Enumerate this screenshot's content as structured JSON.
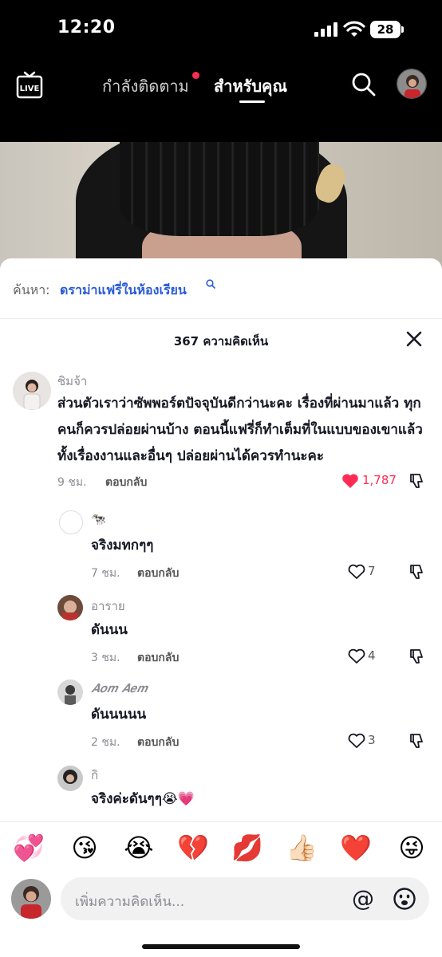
{
  "status_bar": {
    "time": "12:20",
    "battery": "28"
  },
  "top_nav": {
    "live_label": "LIVE",
    "following_tab": "กำลังติดตาม",
    "for_you_tab": "สำหรับคุณ"
  },
  "search_suggestion": {
    "prefix": "ค้นหา:",
    "query": "ดราม่าแฟรี่ในห้องเรียน"
  },
  "comments_header": {
    "count_label": "367 ความคิดเห็น"
  },
  "comments": [
    {
      "username": "ชิมจ้า",
      "text": "ส่วนตัวเราว่าซัพพอร์ตปัจจุบันดีกว่านะคะ เรื่องที่ผ่านมาแล้ว ทุกคนก็ควรปล่อยผ่านบ้าง ตอนนี้แฟรี่ก็ทำเต็มที่ในแบบของเขาแล้ว ทั้งเรื่องงานและอื่นๆ ปล่อยผ่านได้ควรทำนะคะ",
      "time": "9 ชม.",
      "reply_label": "ตอบกลับ",
      "likes": "1,787",
      "liked": true
    },
    {
      "username": "🐄",
      "text": "จริงมทกๆๆ",
      "time": "7 ชม.",
      "reply_label": "ตอบกลับ",
      "likes": "7",
      "liked": false
    },
    {
      "username": "อาราย",
      "text": "ดันนน",
      "time": "3 ชม.",
      "reply_label": "ตอบกลับ",
      "likes": "4",
      "liked": false
    },
    {
      "username": "𝑨𝒐𝒎 𝑨𝒆𝒎",
      "text": "ดันนนนน",
      "time": "2 ชม.",
      "reply_label": "ตอบกลับ",
      "likes": "3",
      "liked": false
    },
    {
      "username": "กิ",
      "text": "จริงค่ะดันๆๆ😭💗",
      "time": "",
      "reply_label": "",
      "likes": "",
      "liked": false
    }
  ],
  "emoji_bar": [
    "💞",
    "😘",
    "😭",
    "💔",
    "💋",
    "👍🏻",
    "❤️",
    "😜"
  ],
  "input": {
    "placeholder": "เพิ่มความคิดเห็น...",
    "mention_symbol": "@"
  },
  "colors": {
    "like_red": "#fe2c55",
    "link_blue": "#2a5bd7",
    "text": "#161823",
    "muted": "#8a8b91"
  },
  "icons": [
    "live-icon",
    "search-icon",
    "close-icon",
    "heart-icon",
    "dislike-icon",
    "at-icon",
    "emoji-icon"
  ]
}
